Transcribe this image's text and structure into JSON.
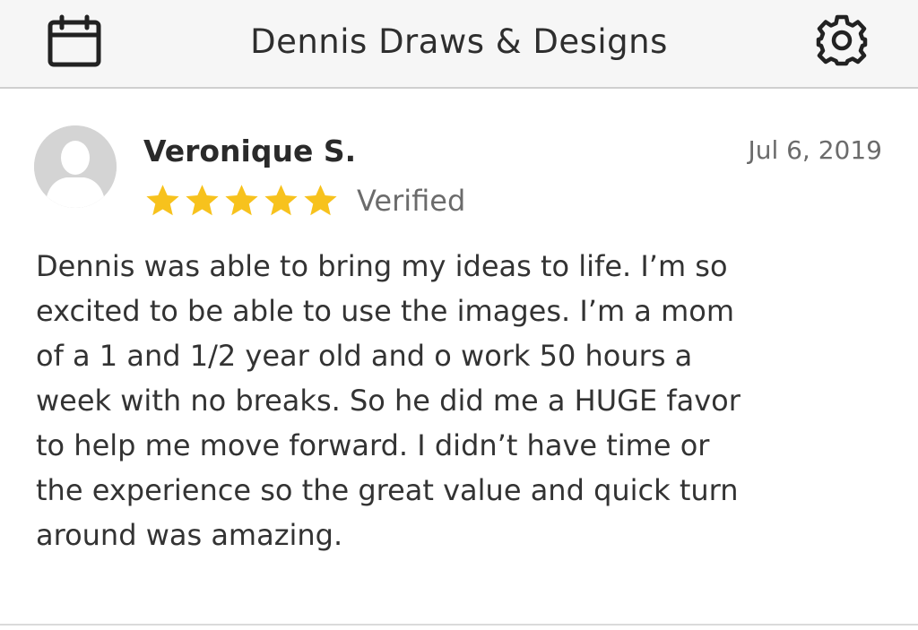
{
  "header": {
    "title": "Dennis Draws & Designs",
    "left_icon": "calendar-icon",
    "right_icon": "gear-icon"
  },
  "review": {
    "reviewer_name": "Veronique S.",
    "date": "Jul 6, 2019",
    "rating": 5,
    "max_rating": 5,
    "verified_label": "Verified",
    "avatar_icon": "user-silhouette-icon",
    "text": "Dennis was able to bring my ideas to life.  I’m so\nexcited to be able to use the images. I’m a mom\nof a 1 and 1/2 year old and o work 50 hours a\nweek with no breaks. So he did me a HUGE favor\nto help me move forward. I didn’t have time or\nthe experience so the great value and quick turn\naround was amazing."
  },
  "colors": {
    "star": "#f7c21d",
    "header_bg": "#f6f6f6",
    "avatar_bg": "#d4d4d4"
  }
}
